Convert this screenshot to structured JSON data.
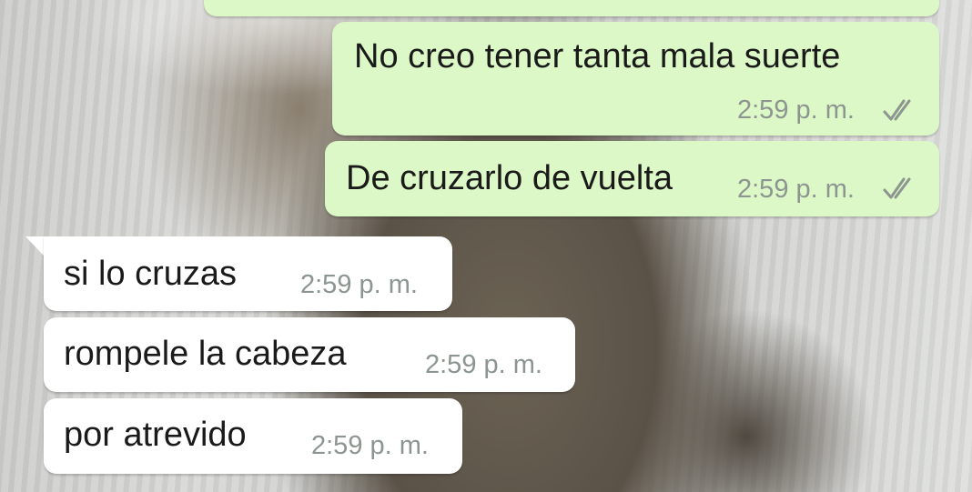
{
  "chat": {
    "messages": [
      {
        "id": "m0",
        "direction": "outgoing",
        "text": "",
        "time": "",
        "status": "read"
      },
      {
        "id": "m1",
        "direction": "outgoing",
        "text": "No creo tener tanta mala suerte",
        "time": "2:59 p. m.",
        "status": "read"
      },
      {
        "id": "m2",
        "direction": "outgoing",
        "text": "De cruzarlo de vuelta",
        "time": "2:59 p. m.",
        "status": "read"
      },
      {
        "id": "m3",
        "direction": "incoming",
        "text": "si lo cruzas",
        "time": "2:59 p. m."
      },
      {
        "id": "m4",
        "direction": "incoming",
        "text": "rompele la cabeza",
        "time": "2:59 p. m."
      },
      {
        "id": "m5",
        "direction": "incoming",
        "text": "por atrevido",
        "time": "2:59 p. m."
      }
    ]
  },
  "colors": {
    "outgoing_bubble": "#dcf8c6",
    "incoming_bubble": "#ffffff",
    "timestamp": "#8c9590",
    "read_ticks": "#8c9590"
  },
  "icons": {
    "read_receipt": "double-check-icon"
  }
}
